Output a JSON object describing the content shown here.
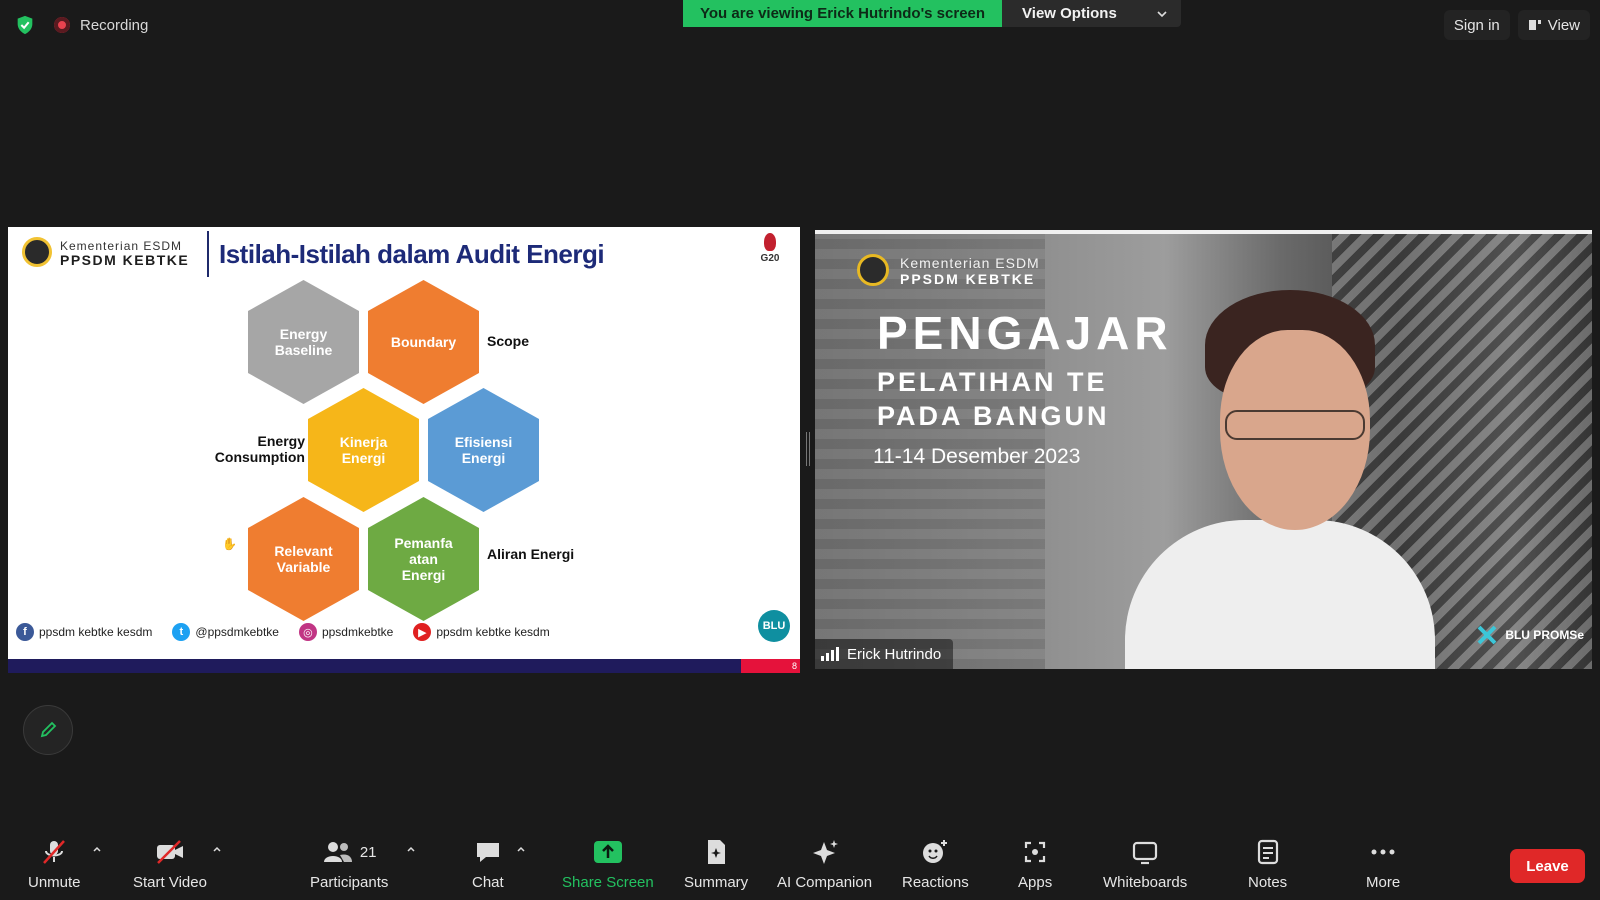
{
  "top_bar": {
    "recording_label": "Recording",
    "banner_text": "You are viewing Erick Hutrindo's screen",
    "view_options_label": "View Options",
    "sign_in_label": "Sign in",
    "view_label": "View"
  },
  "slide": {
    "org_line1": "Kementerian ESDM",
    "org_line2": "PPSDM KEBTKE",
    "title": "Istilah-Istilah dalam Audit Energi",
    "g20_label": "G20",
    "hexagons": [
      {
        "label": "Energy Baseline",
        "color": "#a6a6a6"
      },
      {
        "label": "Boundary",
        "color": "#ef7d30"
      },
      {
        "label": "Kinerja Energi",
        "color": "#f6b619"
      },
      {
        "label": "Efisiensi Energi",
        "color": "#5b9bd5"
      },
      {
        "label": "Relevant Variable",
        "color": "#ef7d30"
      },
      {
        "label": "Pemanfa atan Energi",
        "color": "#6eaa43"
      }
    ],
    "side_labels": {
      "scope": "Scope",
      "energy_consumption": "Energy Consumption",
      "aliran_energi": "Aliran Energi"
    },
    "social": [
      {
        "icon": "facebook-icon",
        "text": "ppsdm kebtke kesdm"
      },
      {
        "icon": "twitter-icon",
        "text": "@ppsdmkebtke"
      },
      {
        "icon": "instagram-icon",
        "text": "ppsdmkebtke"
      },
      {
        "icon": "youtube-icon",
        "text": "ppsdm kebtke kesdm"
      }
    ],
    "blu_label": "BLU",
    "page_number": "8"
  },
  "video": {
    "org_line1": "Kementerian ESDM",
    "org_line2": "PPSDM KEBTKE",
    "big_text": "PENGAJAR",
    "sub_line1": "PELATIHAN TE           ENERGI",
    "sub_line2": "PADA BANGUN           G",
    "date_text": "11-14 Desember 2023",
    "footer_brand": "BLU PROMSe",
    "participant_name": "Erick Hutrindo"
  },
  "toolbar": {
    "unmute": "Unmute",
    "start_video": "Start Video",
    "participants": "Participants",
    "participants_count": "21",
    "chat": "Chat",
    "share_screen": "Share Screen",
    "summary": "Summary",
    "ai_companion": "AI Companion",
    "reactions": "Reactions",
    "apps": "Apps",
    "whiteboards": "Whiteboards",
    "notes": "Notes",
    "more": "More",
    "leave": "Leave"
  },
  "colors": {
    "share_green": "#23c160",
    "leave_red": "#e02828",
    "title_navy": "#1d2a78"
  }
}
